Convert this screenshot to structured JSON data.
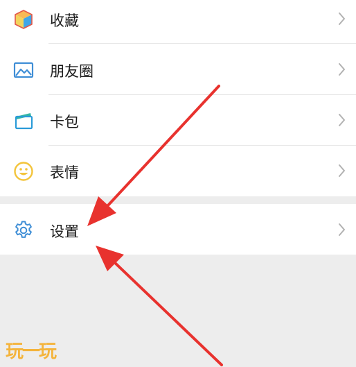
{
  "menu": {
    "items": [
      {
        "label": "收藏",
        "icon": "favorites-cube-icon"
      },
      {
        "label": "朋友圈",
        "icon": "moments-picture-icon"
      },
      {
        "label": "卡包",
        "icon": "card-wallet-icon"
      },
      {
        "label": "表情",
        "icon": "sticker-smiley-icon"
      }
    ],
    "settings": {
      "label": "设置",
      "icon": "gear-icon"
    }
  },
  "annotation": {
    "arrow_color": "#e8322e"
  },
  "watermark": {
    "text": "玩一玩"
  },
  "colors": {
    "background": "#ededed",
    "row_background": "#ffffff",
    "label_text": "#1c1c1c",
    "chevron": "#b2b2b2",
    "icon_blue": "#3f8ed6"
  }
}
